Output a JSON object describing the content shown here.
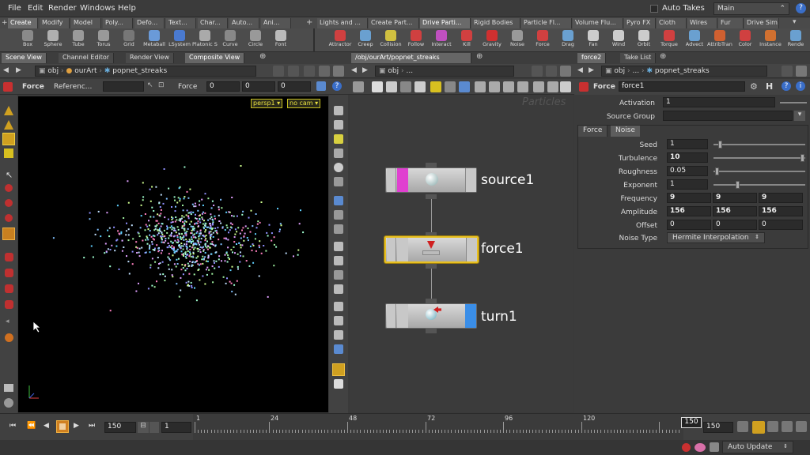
{
  "menubar": {
    "items": [
      "File",
      "Edit",
      "Render",
      "Windows",
      "Help"
    ],
    "auto_takes": "Auto Takes",
    "desktop": "Main",
    "help": "?"
  },
  "shelf_tabs_left": [
    "Create",
    "Modify",
    "Model",
    "Poly...",
    "Defo...",
    "Text...",
    "Char...",
    "Auto...",
    "Ani..."
  ],
  "shelf_tabs_right": [
    "Lights and ...",
    "Create Part...",
    "Drive Parti...",
    "Rigid Bodies",
    "Particle Fl...",
    "Volume Flu...",
    "Pyro FX",
    "Cloth",
    "Wires",
    "Fur",
    "Drive Sim..."
  ],
  "tools_left": [
    {
      "label": "Box",
      "icon": "box-icon",
      "color": "#8a8a8a"
    },
    {
      "label": "Sphere",
      "icon": "sphere-icon",
      "color": "#b0b0b0"
    },
    {
      "label": "Tube",
      "icon": "tube-icon",
      "color": "#9a9a9a"
    },
    {
      "label": "Torus",
      "icon": "torus-icon",
      "color": "#999"
    },
    {
      "label": "Grid",
      "icon": "grid-icon",
      "color": "#777"
    },
    {
      "label": "Metaball",
      "icon": "metaball-icon",
      "color": "#6a9ad8"
    },
    {
      "label": "LSystem",
      "icon": "lsystem-icon",
      "color": "#4a7ad0"
    },
    {
      "label": "Platonic S...",
      "icon": "platonic-icon",
      "color": "#aaa"
    },
    {
      "label": "Curve",
      "icon": "curve-icon",
      "color": "#888"
    },
    {
      "label": "Circle",
      "icon": "circle-icon",
      "color": "#999"
    },
    {
      "label": "Font",
      "icon": "font-icon",
      "color": "#bbb"
    }
  ],
  "tools_right": [
    {
      "label": "Attractor",
      "icon": "attractor-icon",
      "color": "#d04040"
    },
    {
      "label": "Creep",
      "icon": "creep-icon",
      "color": "#6aa0d0"
    },
    {
      "label": "Collision",
      "icon": "collision-icon",
      "color": "#d0c040"
    },
    {
      "label": "Follow",
      "icon": "follow-icon",
      "color": "#d04040"
    },
    {
      "label": "Interact",
      "icon": "interact-icon",
      "color": "#c050c0"
    },
    {
      "label": "Kill",
      "icon": "kill-icon",
      "color": "#d04040"
    },
    {
      "label": "Gravity",
      "icon": "gravity-icon",
      "color": "#d03030"
    },
    {
      "label": "Noise",
      "icon": "noise-icon",
      "color": "#999"
    },
    {
      "label": "Force",
      "icon": "force-icon",
      "color": "#d04040"
    },
    {
      "label": "Drag",
      "icon": "drag-icon",
      "color": "#6aa0d0"
    },
    {
      "label": "Fan",
      "icon": "fan-icon",
      "color": "#ccc"
    },
    {
      "label": "Wind",
      "icon": "wind-icon",
      "color": "#ccc"
    },
    {
      "label": "Orbit",
      "icon": "orbit-icon",
      "color": "#ccc"
    },
    {
      "label": "Torque",
      "icon": "torque-icon",
      "color": "#d04040"
    },
    {
      "label": "Advect",
      "icon": "advect-icon",
      "color": "#6aa0d0"
    },
    {
      "label": "AttribTran...",
      "icon": "attribtransfer-icon",
      "color": "#d06030"
    },
    {
      "label": "Color",
      "icon": "color-icon",
      "color": "#d04040"
    },
    {
      "label": "Instance",
      "icon": "instance-icon",
      "color": "#d07030"
    },
    {
      "label": "Rende",
      "icon": "render-icon",
      "color": "#6aa0d0"
    }
  ],
  "left_panel": {
    "tabs": [
      "Scene View",
      "Channel Editor",
      "Render View",
      "Composite View"
    ],
    "path": [
      "obj",
      "ourArt",
      "popnet_streaks"
    ],
    "op_label": "Force",
    "reference_label": "Referenc...",
    "force_label": "Force",
    "force_values": [
      "0",
      "0",
      "0"
    ],
    "camera_menu": "persp1",
    "cam_menu": "no cam"
  },
  "network": {
    "tab_path": "/obj/ourArt/popnet_streaks",
    "path": [
      "obj",
      "..."
    ],
    "context_watermark": "Particles",
    "nodes": [
      {
        "name": "source1",
        "flag_color": "#e040d0",
        "selected": false
      },
      {
        "name": "force1",
        "flag_color": "#b0b0b0",
        "selected": true
      },
      {
        "name": "turn1",
        "flag_color": "#3a8ee8",
        "selected": false
      }
    ]
  },
  "params": {
    "tabs": [
      "force2",
      "Take List"
    ],
    "path": [
      "obj",
      "...",
      "popnet_streaks"
    ],
    "op_type": "Force",
    "op_name": "force1",
    "activation_label": "Activation",
    "activation_value": "1",
    "source_group_label": "Source Group",
    "source_group_value": "",
    "subtabs": [
      "Force",
      "Noise"
    ],
    "rows": [
      {
        "label": "Seed",
        "values": [
          "1"
        ]
      },
      {
        "label": "Turbulence",
        "values": [
          "10"
        ]
      },
      {
        "label": "Roughness",
        "values": [
          "0.05"
        ]
      },
      {
        "label": "Exponent",
        "values": [
          "1"
        ]
      },
      {
        "label": "Frequency",
        "values": [
          "9",
          "9",
          "9"
        ]
      },
      {
        "label": "Amplitude",
        "values": [
          "156",
          "156",
          "156"
        ]
      },
      {
        "label": "Offset",
        "values": [
          "0",
          "0",
          "0"
        ]
      }
    ],
    "noise_type_label": "Noise Type",
    "noise_type_value": "Hermite Interpolation"
  },
  "timeline": {
    "current_frame": "150",
    "start_frame": "1",
    "end_frame": "150",
    "ticks": [
      "1",
      "24",
      "48",
      "72",
      "96",
      "120",
      "150"
    ],
    "cursor_frame": "150"
  },
  "status": {
    "auto_update": "Auto Update"
  }
}
